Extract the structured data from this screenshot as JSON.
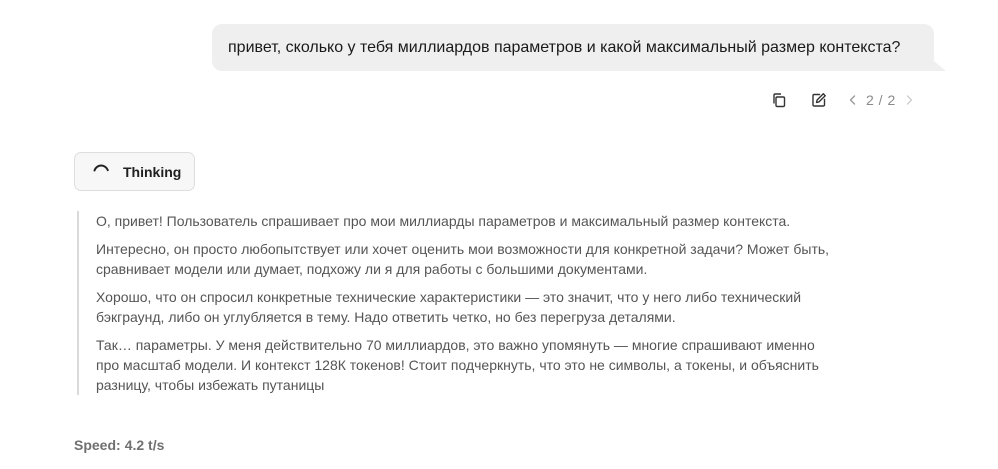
{
  "user_message": {
    "text": "привет, сколько у тебя миллиардов параметров и какой максимальный размер контекста?"
  },
  "message_actions": {
    "copy_icon": "copy-icon",
    "edit_icon": "edit-icon",
    "pager": {
      "current": 2,
      "total": 2,
      "label": "2 / 2"
    }
  },
  "thinking": {
    "label": "Thinking",
    "icon": "spinner-icon"
  },
  "reasoning": {
    "paragraphs": [
      "О, привет! Пользователь спрашивает про мои миллиарды параметров и максимальный размер контекста.",
      "Интересно, он просто любопытствует или хочет оценить мои возможности для конкретной задачи? Может быть, сравнивает модели или думает, подхожу ли я для работы с большими документами.",
      "Хорошо, что он спросил конкретные технические характеристики — это значит, что у него либо технический бэкграунд, либо он углубляется в тему. Надо ответить четко, но без перегруза деталями.",
      "Так… параметры. У меня действительно 70 миллиардов, это важно упомянуть — многие спрашивают именно про масштаб модели. И контекст 128К токенов! Стоит подчеркнуть, что это не символы, а токены, и объяснить разницу, чтобы избежать путаницы"
    ]
  },
  "speed": {
    "label": "Speed:",
    "value": "4.2 t/s"
  },
  "colors": {
    "user_bubble": "#efefef",
    "reasoning_border": "#dadada",
    "reasoning_text": "#555555",
    "muted": "#8a8a8a"
  }
}
